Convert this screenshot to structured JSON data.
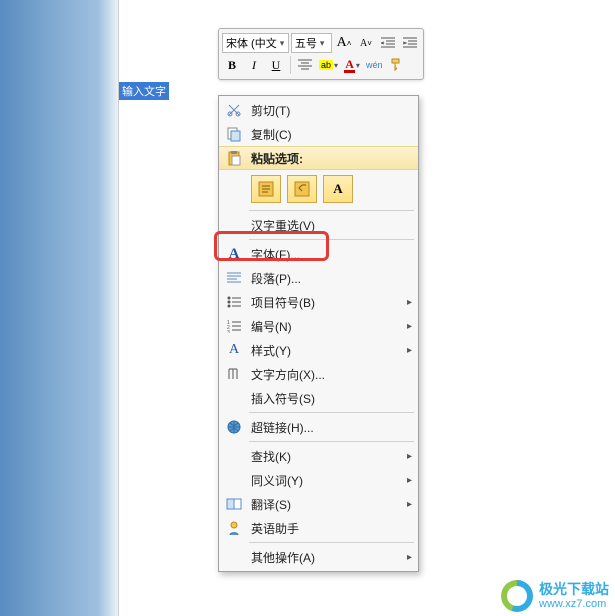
{
  "toolbar": {
    "font_name": "宋体 (中文",
    "font_size": "五号",
    "grow_font": "A",
    "shrink_font": "A",
    "bold": "B",
    "italic": "I",
    "underline": "U",
    "highlight": "ab",
    "font_color": "A",
    "phonetic": "wén"
  },
  "placeholder": "输入文字",
  "menu": {
    "cut": "剪切(T)",
    "copy": "复制(C)",
    "paste_options_header": "粘贴选项:",
    "paste_opt_text": "A",
    "reconvert": "汉字重选(V)",
    "font": "字体(F)...",
    "paragraph": "段落(P)...",
    "bullets": "项目符号(B)",
    "numbering": "编号(N)",
    "styles": "样式(Y)",
    "text_direction": "文字方向(X)...",
    "insert_symbol": "插入符号(S)",
    "hyperlink": "超链接(H)...",
    "find": "查找(K)",
    "synonyms": "同义词(Y)",
    "translate": "翻译(S)",
    "english_assistant": "英语助手",
    "other": "其他操作(A)",
    "submenu_arrow": "▸"
  },
  "watermark": {
    "cn": "极光下载站",
    "url": "www.xz7.com"
  }
}
